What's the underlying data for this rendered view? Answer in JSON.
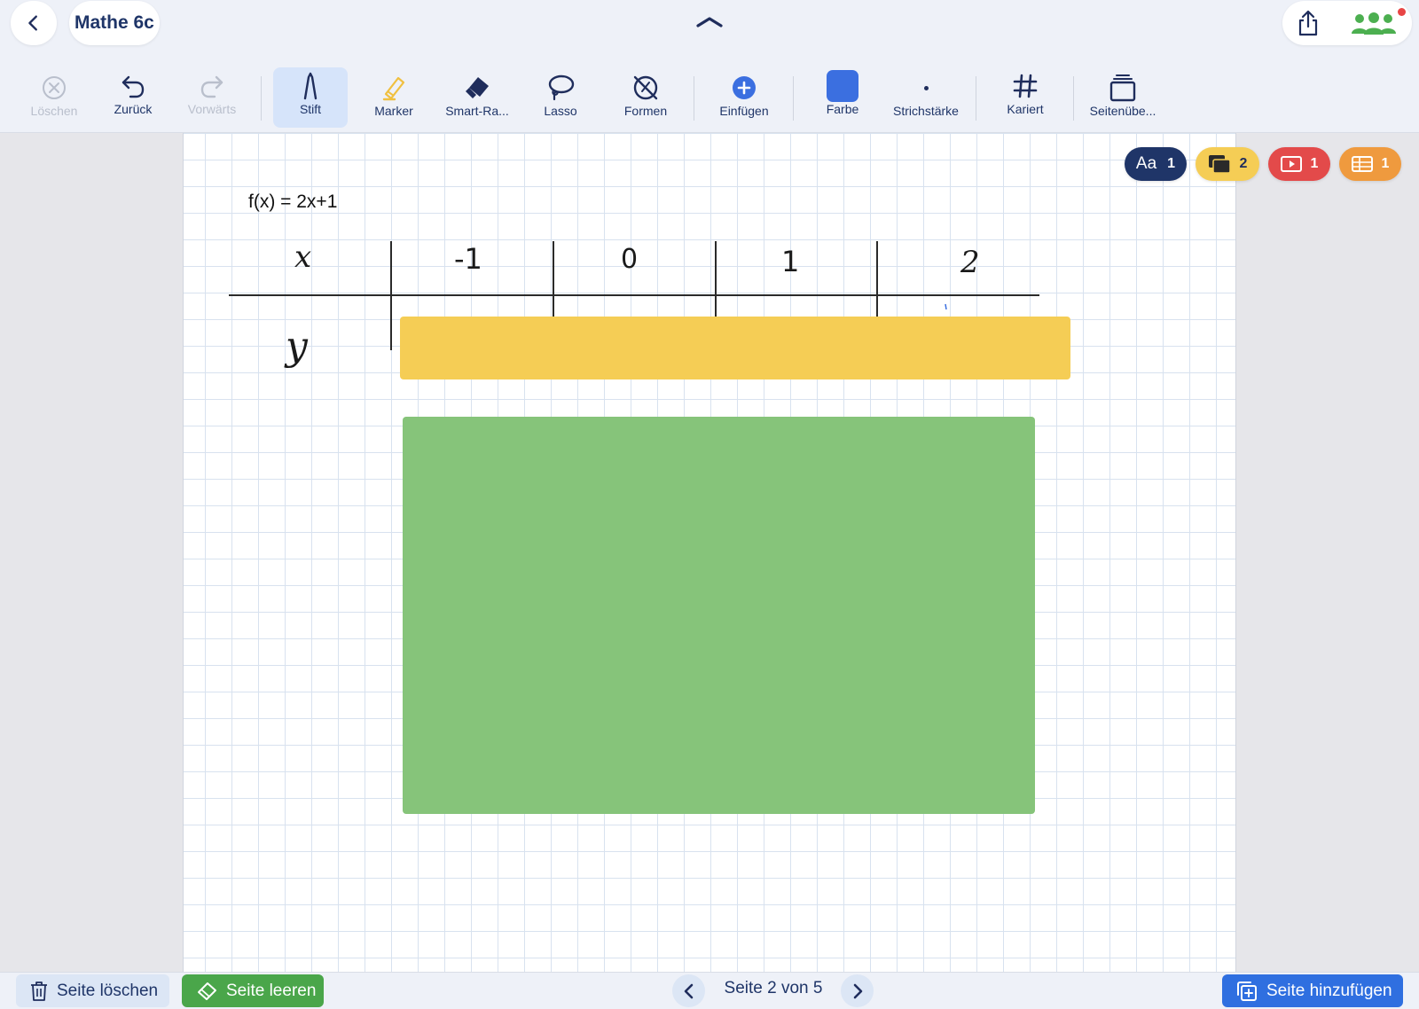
{
  "header": {
    "title": "Mathe 6c",
    "back_icon": "chevron-left-icon",
    "collapse_icon": "chevron-up-icon",
    "share_icon": "share-icon",
    "collaborators_icon": "people-icon"
  },
  "toolbar": {
    "items": [
      {
        "label": "Löschen",
        "icon": "x-circle-icon",
        "disabled": true
      },
      {
        "label": "Zurück",
        "icon": "undo-icon",
        "disabled": false
      },
      {
        "label": "Vorwärts",
        "icon": "redo-icon",
        "disabled": true
      },
      {
        "label": "Stift",
        "icon": "pen-icon",
        "active": true
      },
      {
        "label": "Marker",
        "icon": "highlighter-icon"
      },
      {
        "label": "Smart-Ra...",
        "icon": "eraser-icon"
      },
      {
        "label": "Lasso",
        "icon": "lasso-icon"
      },
      {
        "label": "Formen",
        "icon": "shapes-icon"
      },
      {
        "label": "Einfügen",
        "icon": "plus-circle-icon"
      },
      {
        "label": "Farbe",
        "icon": "color-swatch-icon"
      },
      {
        "label": "Strichstärke",
        "icon": "stroke-width-icon"
      },
      {
        "label": "Kariert",
        "icon": "grid-icon"
      },
      {
        "label": "Seitenübe...",
        "icon": "pages-overview-icon"
      }
    ],
    "current_color": "#3b6fe0"
  },
  "canvas": {
    "formula": "f(x) = 2x+1",
    "table": {
      "row_x_header": "x",
      "row_y_header": "y",
      "x_values": [
        "-1",
        "0",
        "1",
        "2"
      ]
    },
    "yellow_block_color": "#f5cd55",
    "green_block_color": "#86c47a"
  },
  "badges": [
    {
      "label": "Aa",
      "count": "1",
      "color": "#1f3568",
      "icon": "text-icon"
    },
    {
      "label": "",
      "count": "2",
      "color": "#f5cd55",
      "icon": "cards-icon"
    },
    {
      "label": "",
      "count": "1",
      "color": "#e34a4a",
      "icon": "video-icon"
    },
    {
      "label": "",
      "count": "1",
      "color": "#ef9a3e",
      "icon": "table-icon"
    }
  ],
  "footer": {
    "delete_page": "Seite löschen",
    "clear_page": "Seite leeren",
    "page_indicator": "Seite 2 von 5",
    "add_page": "Seite hinzufügen"
  }
}
